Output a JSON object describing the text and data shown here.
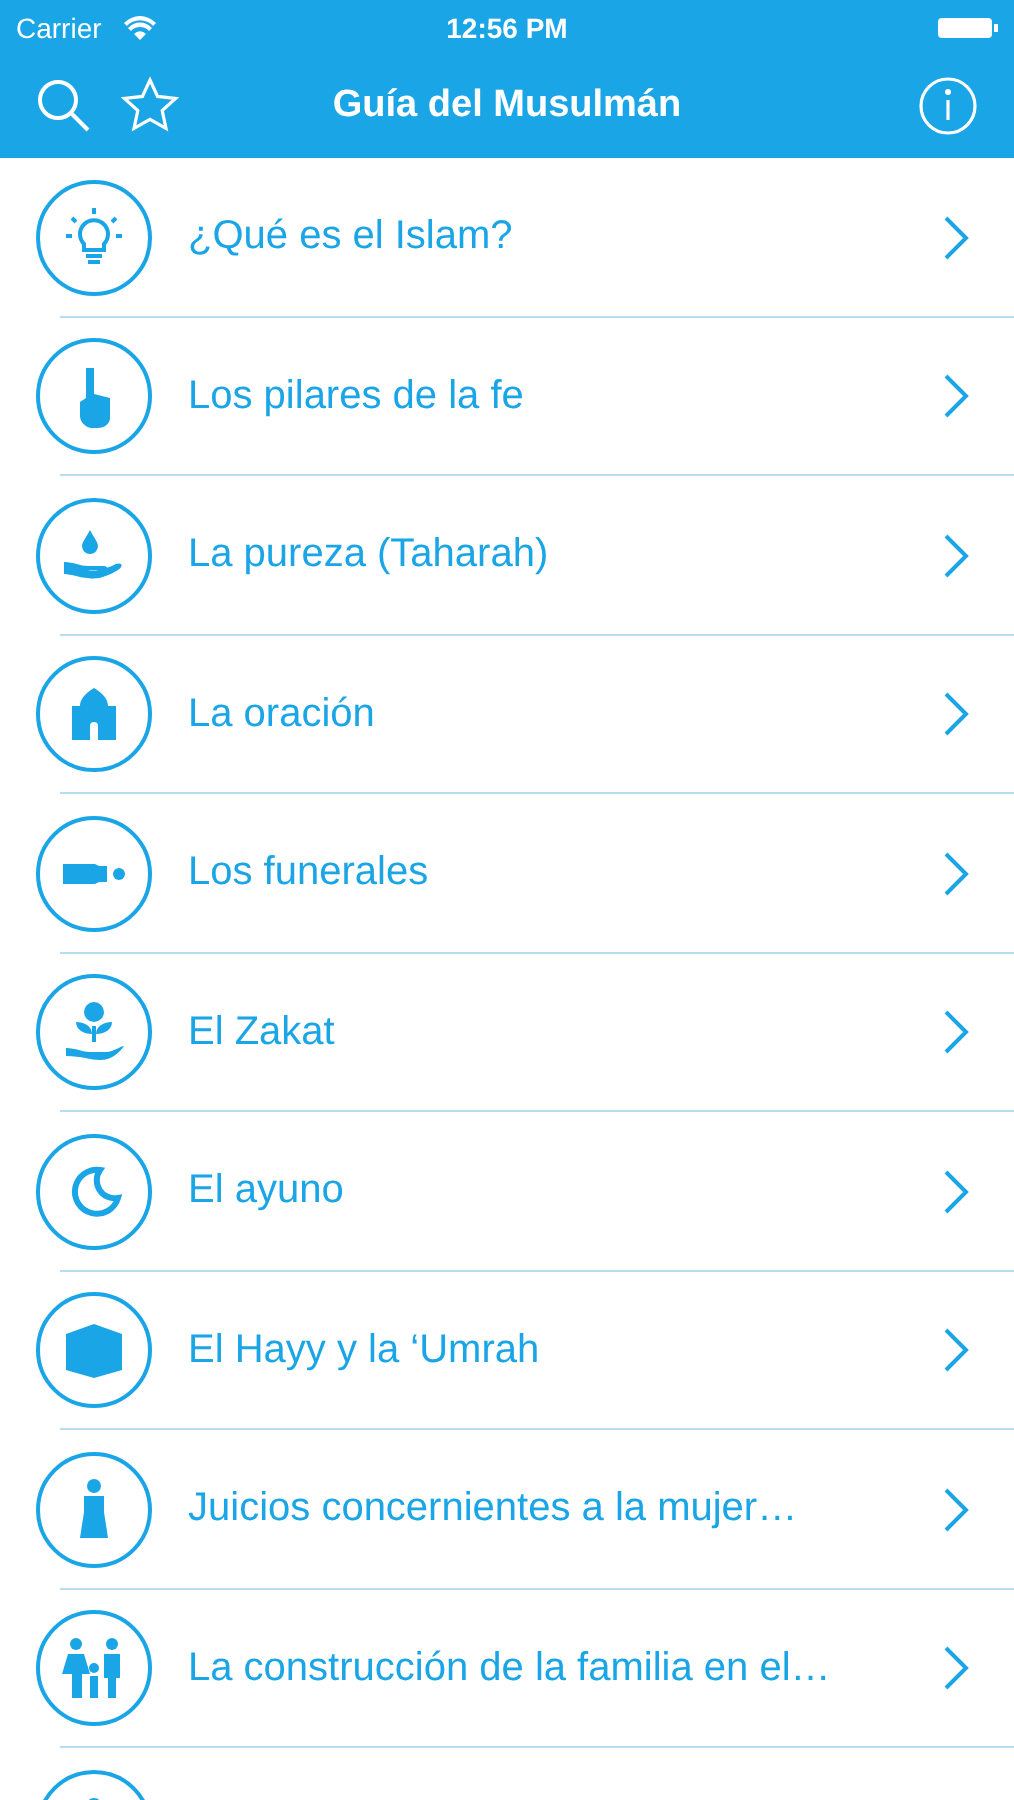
{
  "status_bar": {
    "carrier": "Carrier",
    "time": "12:56 PM"
  },
  "nav": {
    "title": "Guía del Musulmán"
  },
  "items": [
    {
      "label": "¿Qué es el Islam?"
    },
    {
      "label": "Los pilares de la fe"
    },
    {
      "label": "La pureza (Taharah)"
    },
    {
      "label": "La oración"
    },
    {
      "label": "Los funerales"
    },
    {
      "label": "El Zakat"
    },
    {
      "label": "El ayuno"
    },
    {
      "label": "El Hayy y la ‘Umrah"
    },
    {
      "label": "Juicios concernientes a la mujer…"
    },
    {
      "label": "La construcción de la familia en el…"
    }
  ]
}
